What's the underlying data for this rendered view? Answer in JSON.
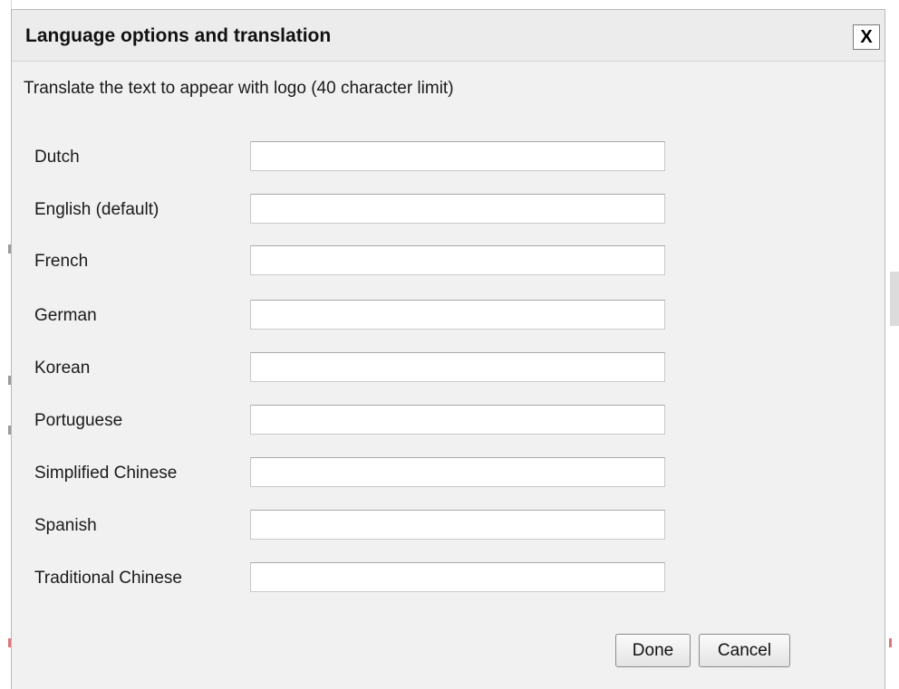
{
  "dialog": {
    "title": "Language options and translation",
    "close_label": "X",
    "instruction": "Translate the text to appear with logo (40 character limit)"
  },
  "fields": [
    {
      "label": "Dutch",
      "value": ""
    },
    {
      "label": "English (default)",
      "value": ""
    },
    {
      "label": "French",
      "value": ""
    },
    {
      "label": "German",
      "value": ""
    },
    {
      "label": "Korean",
      "value": ""
    },
    {
      "label": "Portuguese",
      "value": ""
    },
    {
      "label": "Simplified Chinese",
      "value": ""
    },
    {
      "label": "Spanish",
      "value": ""
    },
    {
      "label": "Traditional Chinese",
      "value": ""
    }
  ],
  "buttons": {
    "done_label": "Done",
    "cancel_label": "Cancel"
  }
}
